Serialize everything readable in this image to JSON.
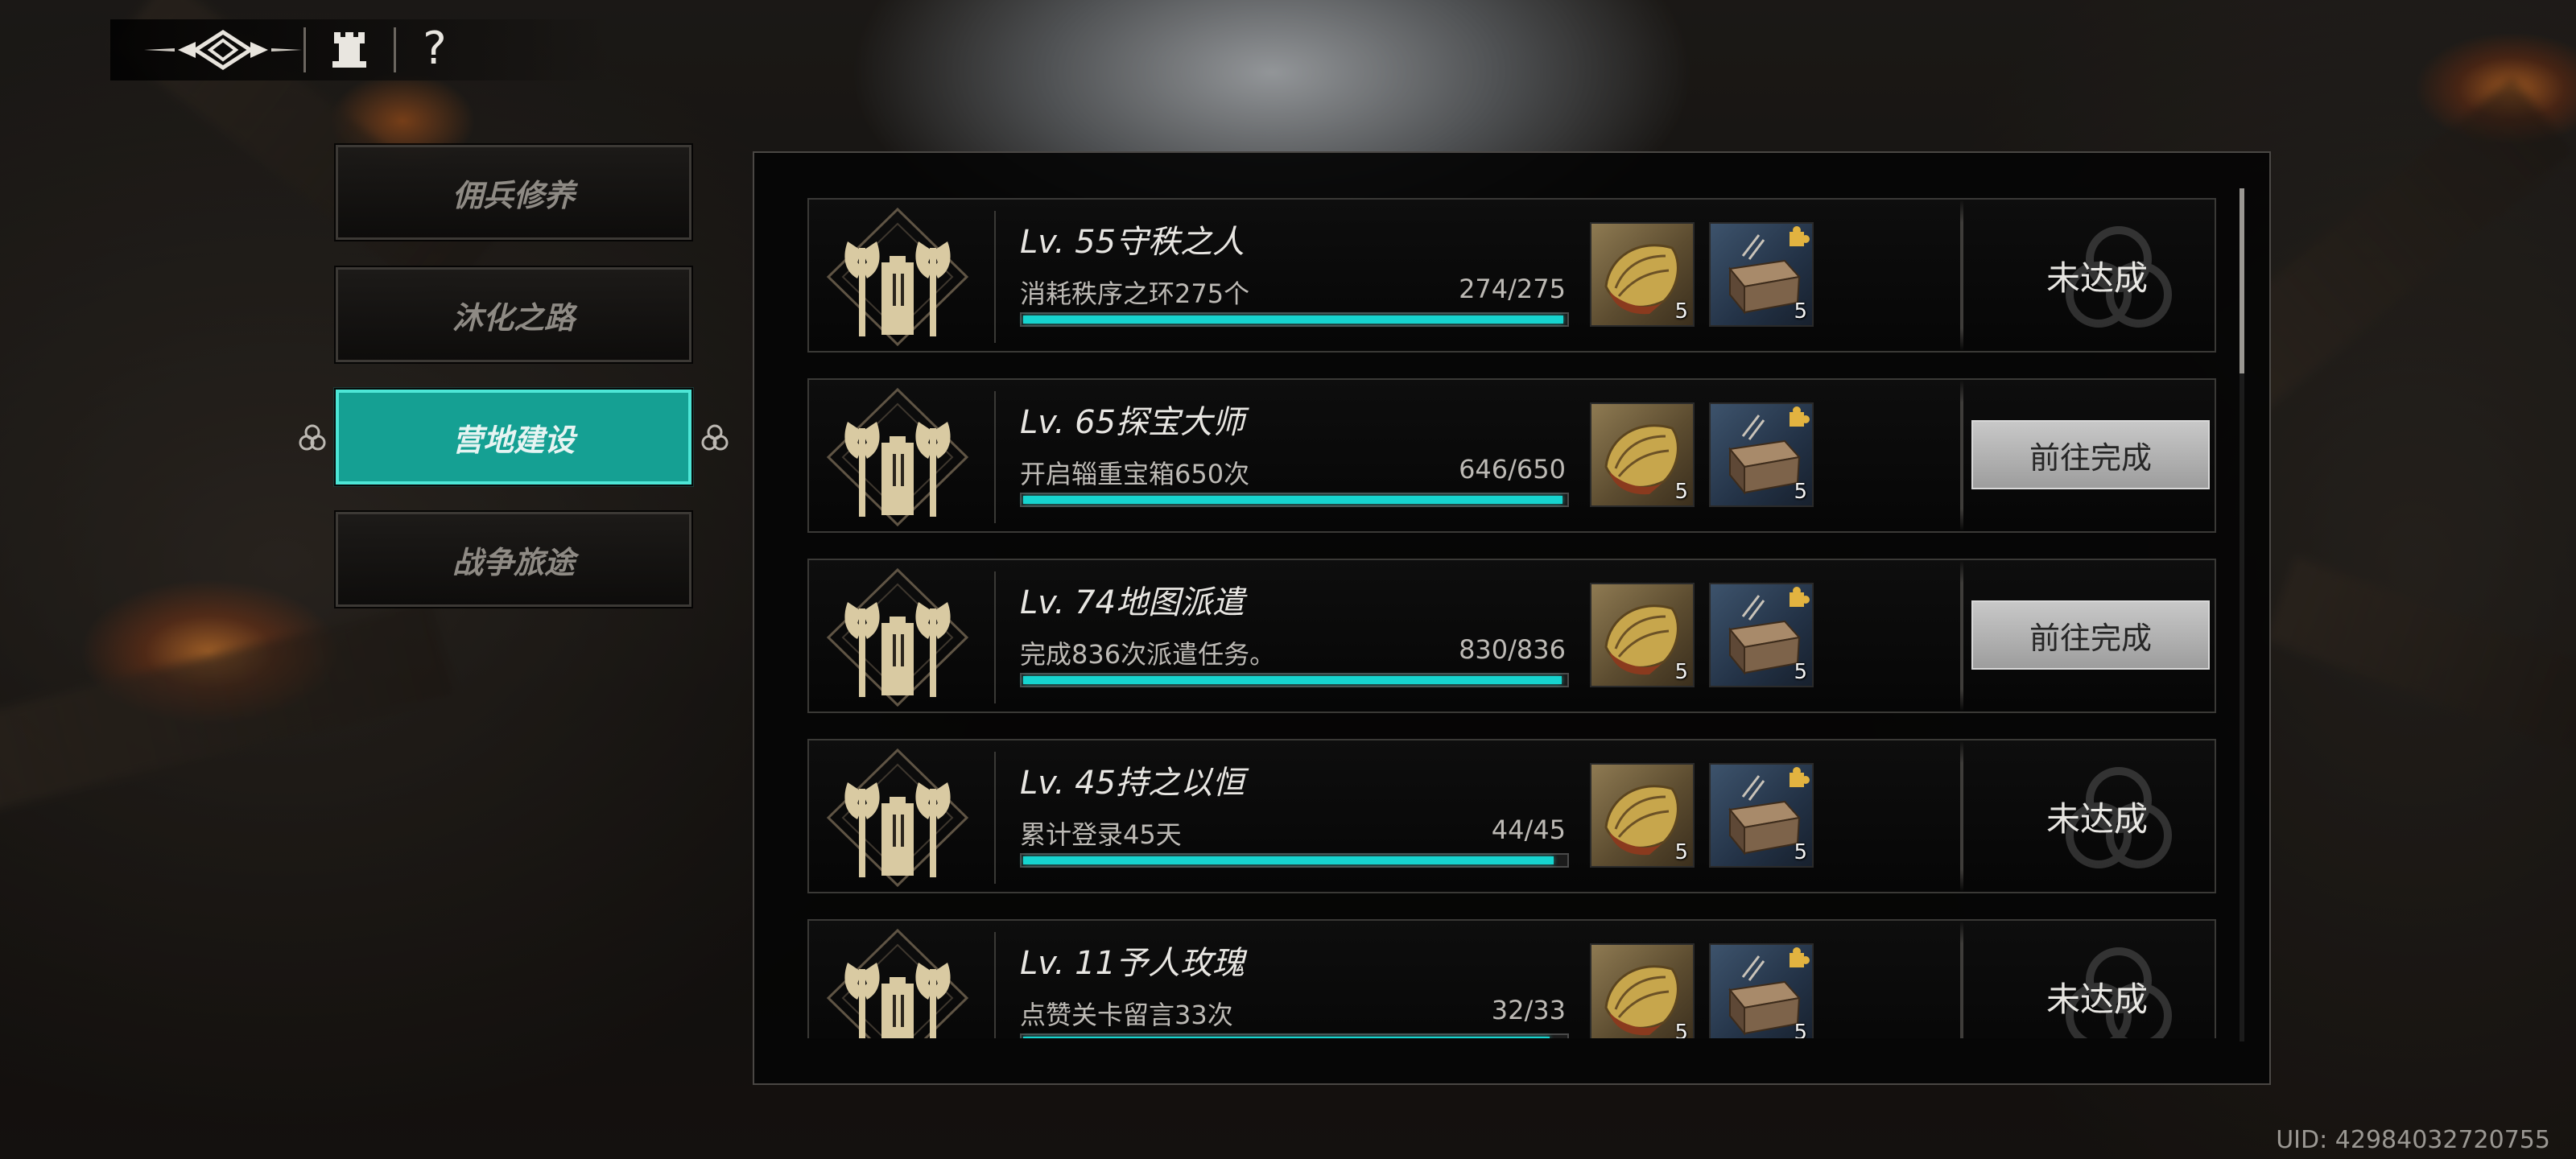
{
  "toolbar": {
    "help_label": "?"
  },
  "tabs": [
    {
      "label": "佣兵修养",
      "active": false
    },
    {
      "label": "沐化之路",
      "active": false
    },
    {
      "label": "营地建设",
      "active": true
    },
    {
      "label": "战争旅途",
      "active": false
    }
  ],
  "achievements": [
    {
      "title": "Lv. 55守秩之人",
      "description": "消耗秩序之环275个",
      "progress_text": "274/275",
      "progress": 0.996,
      "status": "未达成",
      "reward_gold_qty": "5",
      "reward_blue_qty": "5"
    },
    {
      "title": "Lv. 65探宝大师",
      "description": "开启辎重宝箱650次",
      "progress_text": "646/650",
      "progress": 0.994,
      "status": "前往完成",
      "reward_gold_qty": "5",
      "reward_blue_qty": "5"
    },
    {
      "title": "Lv. 74地图派遣",
      "description": "完成836次派遣任务。",
      "progress_text": "830/836",
      "progress": 0.993,
      "status": "前往完成",
      "reward_gold_qty": "5",
      "reward_blue_qty": "5"
    },
    {
      "title": "Lv. 45持之以恒",
      "description": "累计登录45天",
      "progress_text": "44/45",
      "progress": 0.978,
      "status": "未达成",
      "reward_gold_qty": "5",
      "reward_blue_qty": "5"
    },
    {
      "title": "Lv. 11予人玫瑰",
      "description": "点赞关卡留言33次",
      "progress_text": "32/33",
      "progress": 0.97,
      "status": "未达成",
      "reward_gold_qty": "5",
      "reward_blue_qty": "5"
    }
  ],
  "uid": "UID: 42984032720755",
  "colors": {
    "accent": "#15a093",
    "progress": "#16d4cf"
  },
  "icons": [
    "game-logo-icon",
    "tower-icon",
    "help-icon",
    "axe-emblem-icon",
    "gold-shell-item-icon",
    "chest-item-icon",
    "triquetra-watermark-icon"
  ]
}
